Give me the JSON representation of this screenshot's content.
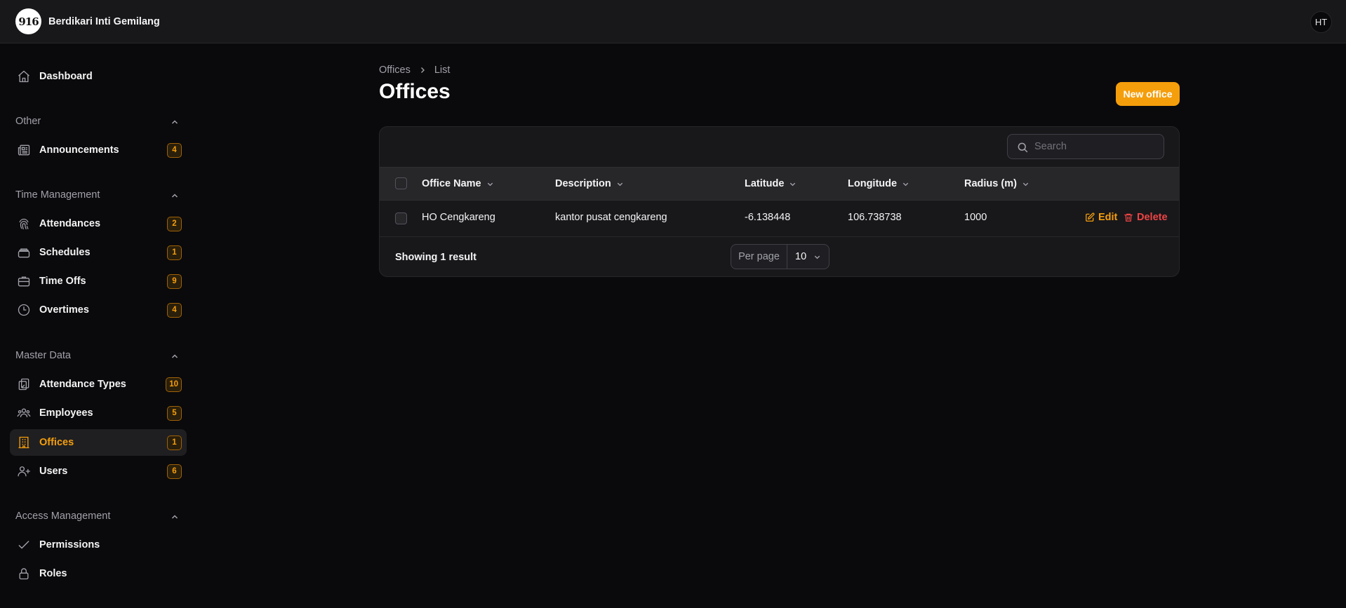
{
  "app": {
    "logo_text": "916",
    "name": "Berdikari Inti Gemilang",
    "user_initials": "HT"
  },
  "sidebar": {
    "dashboard": {
      "label": "Dashboard"
    },
    "groups": {
      "other": {
        "label": "Other"
      },
      "time": {
        "label": "Time Management"
      },
      "master": {
        "label": "Master Data"
      },
      "access": {
        "label": "Access Management"
      }
    },
    "items": {
      "announcements": {
        "label": "Announcements",
        "count": "4",
        "icon": "newspaper-icon"
      },
      "attendances": {
        "label": "Attendances",
        "count": "2",
        "icon": "fingerprint-icon"
      },
      "schedules": {
        "label": "Schedules",
        "count": "1",
        "icon": "stack-icon"
      },
      "timeoffs": {
        "label": "Time Offs",
        "count": "9",
        "icon": "briefcase-icon"
      },
      "overtimes": {
        "label": "Overtimes",
        "count": "4",
        "icon": "clock-icon"
      },
      "attendance_types": {
        "label": "Attendance Types",
        "count": "10",
        "icon": "clipboard-check-icon"
      },
      "employees": {
        "label": "Employees",
        "count": "5",
        "icon": "users-icon"
      },
      "offices": {
        "label": "Offices",
        "count": "1",
        "icon": "building-icon"
      },
      "users": {
        "label": "Users",
        "count": "6",
        "icon": "user-plus-icon"
      },
      "permissions": {
        "label": "Permissions",
        "icon": "check-icon"
      },
      "roles": {
        "label": "Roles",
        "icon": "lock-icon"
      }
    }
  },
  "breadcrumb": {
    "parent": "Offices",
    "current": "List"
  },
  "page": {
    "title": "Offices",
    "new_button": "New office"
  },
  "table": {
    "search_placeholder": "Search",
    "columns": {
      "name": "Office Name",
      "description": "Description",
      "latitude": "Latitude",
      "longitude": "Longitude",
      "radius": "Radius (m)"
    },
    "rows": [
      {
        "name": "HO Cengkareng",
        "description": "kantor pusat cengkareng",
        "latitude": "-6.138448",
        "longitude": "106.738738",
        "radius": "1000",
        "edit_label": "Edit",
        "delete_label": "Delete"
      }
    ],
    "footer": {
      "showing": "Showing 1 result",
      "per_page_label": "Per page",
      "per_page_value": "10"
    }
  },
  "colors": {
    "accent": "#f59e0b",
    "danger": "#ef4444",
    "background": "#0a0a0c",
    "surface": "#18181b"
  }
}
